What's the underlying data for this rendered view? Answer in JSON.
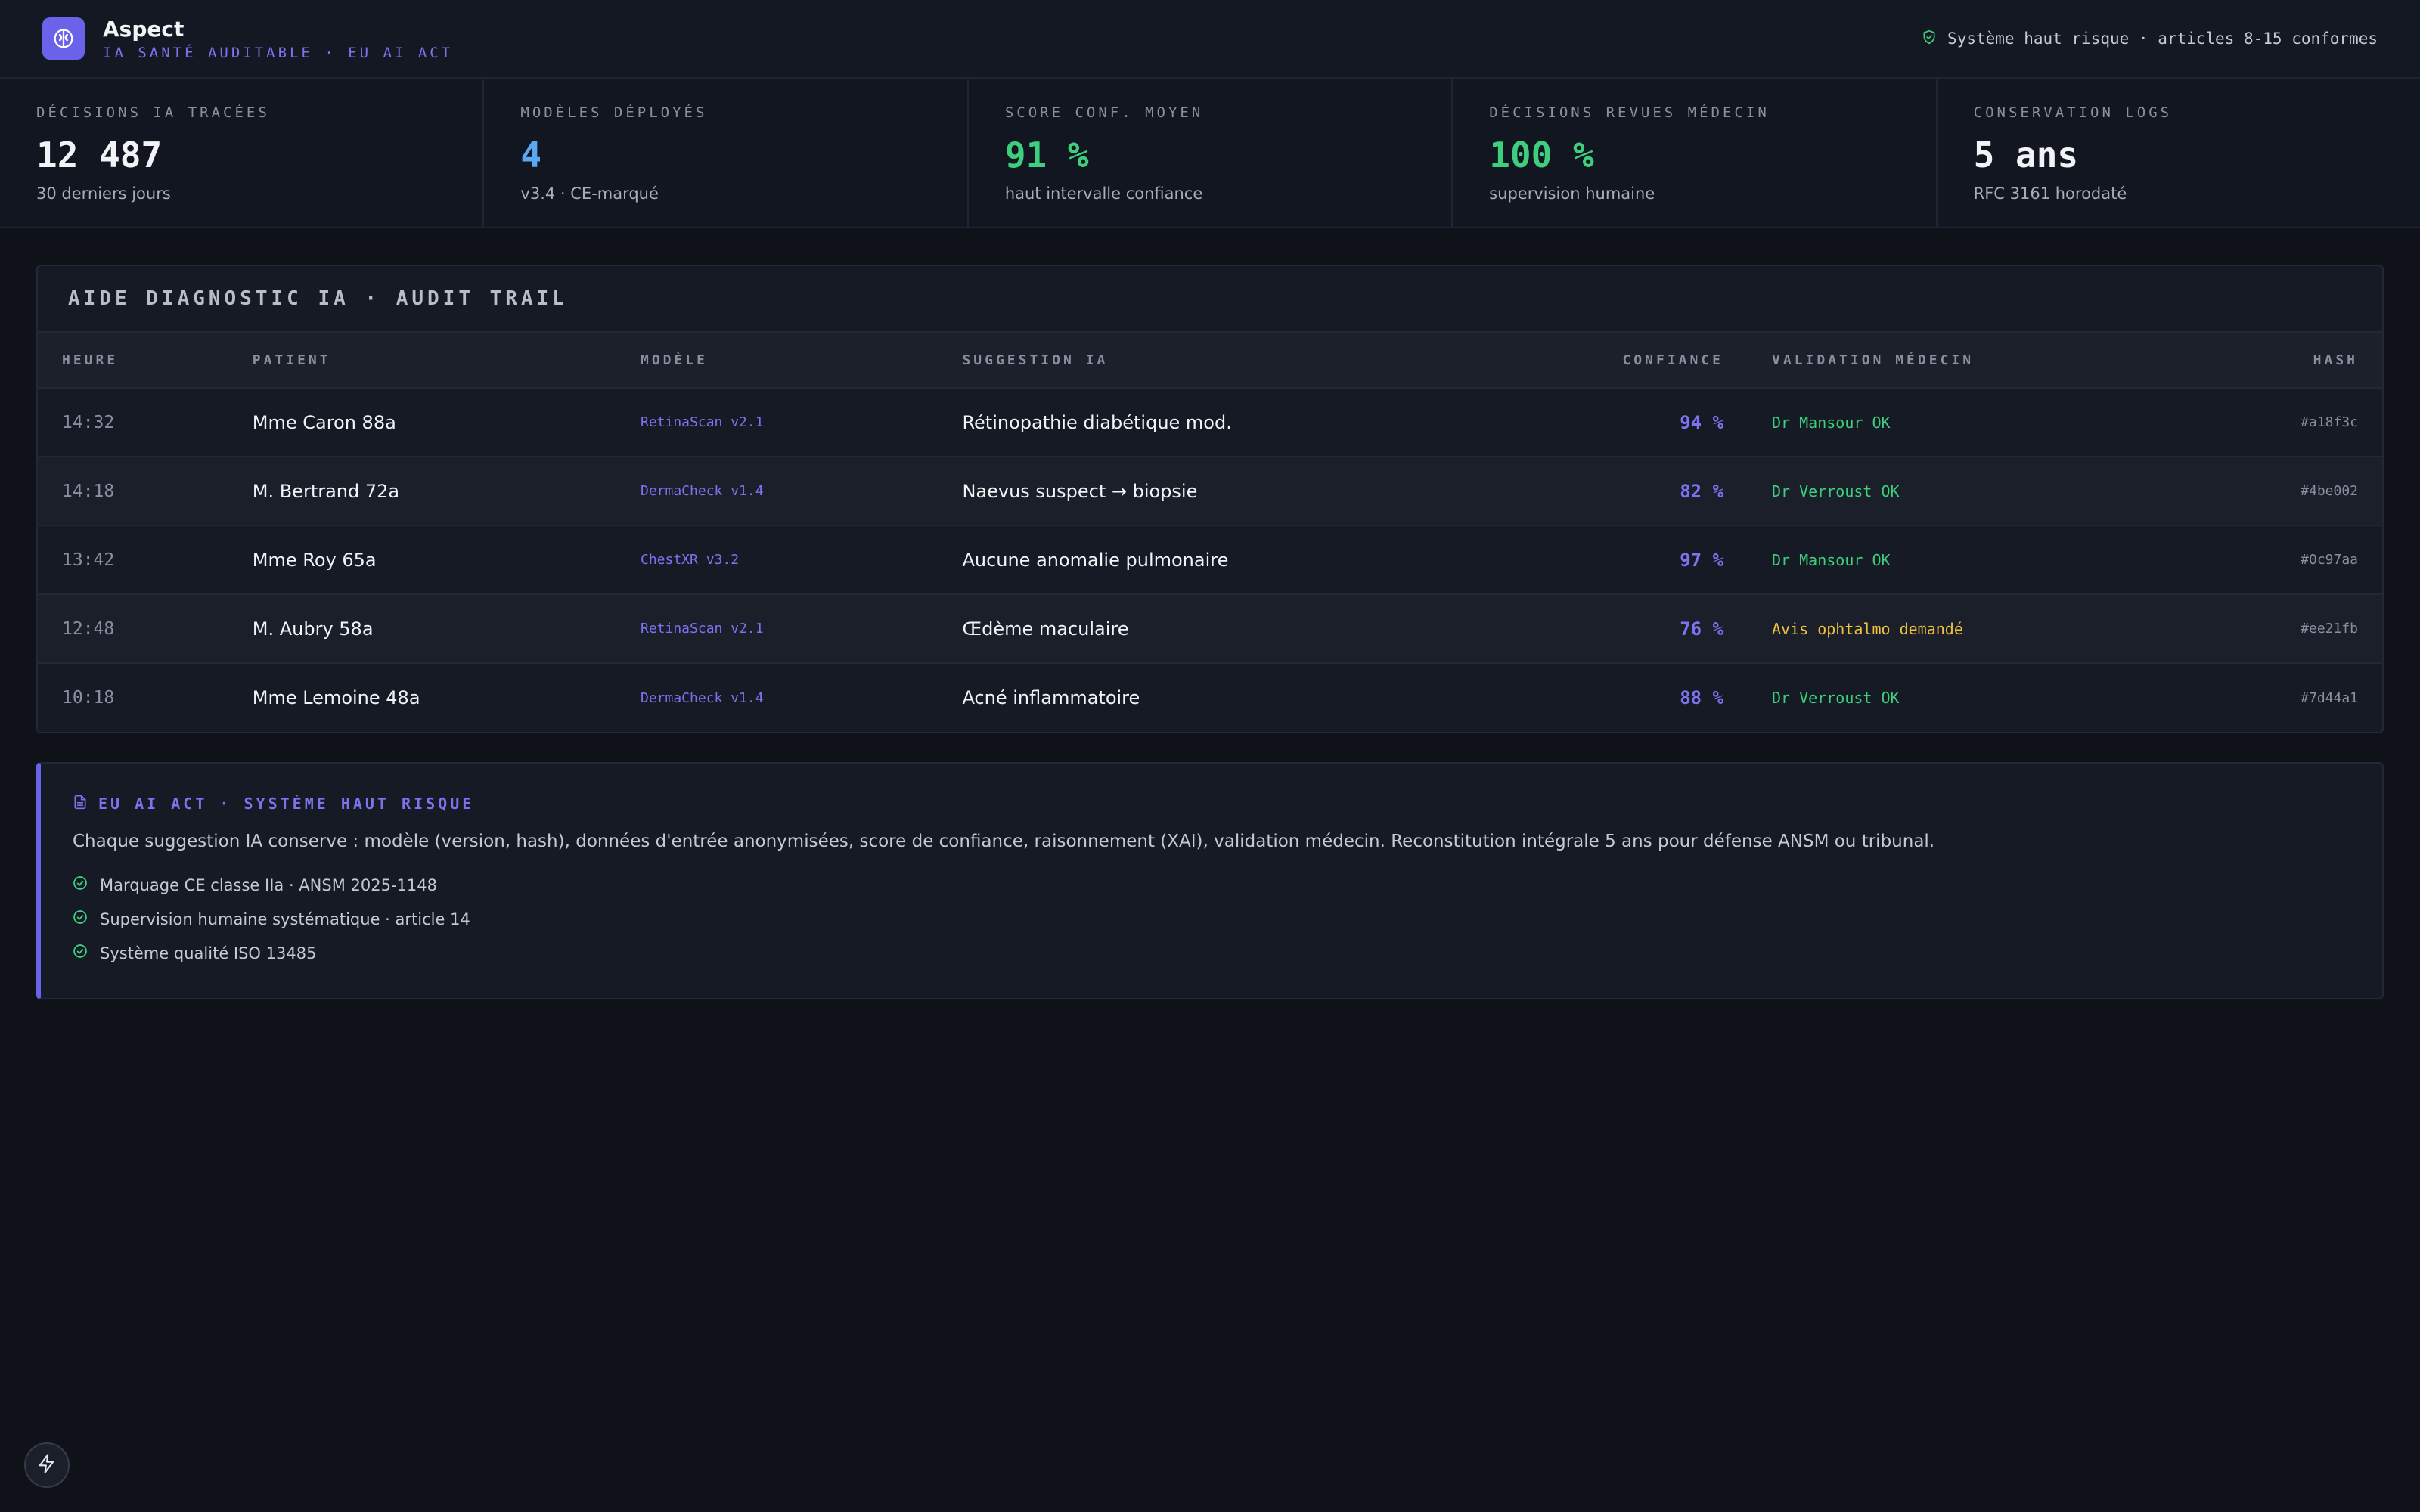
{
  "header": {
    "app_name": "Aspect",
    "subtitle": "IA SANTÉ AUDITABLE · EU AI ACT",
    "compliance": "Système haut risque · articles 8-15 conformes"
  },
  "kpis": [
    {
      "label": "DÉCISIONS IA TRACÉES",
      "value": "12 487",
      "sub": "30 derniers jours"
    },
    {
      "label": "MODÈLES DÉPLOYÉS",
      "value": "4",
      "sub": "v3.4 · CE-marqué"
    },
    {
      "label": "SCORE CONF. MOYEN",
      "value": "91 %",
      "sub": "haut intervalle confiance"
    },
    {
      "label": "DÉCISIONS REVUES MÉDECIN",
      "value": "100 %",
      "sub": "supervision humaine"
    },
    {
      "label": "CONSERVATION LOGS",
      "value": "5 ans",
      "sub": "RFC 3161 horodaté"
    }
  ],
  "kpi_colors": [
    "#f2f3f7",
    "#5aa9f0",
    "#3ecf7e",
    "#3ecf7e",
    "#f2f3f7"
  ],
  "audit": {
    "title": "AIDE DIAGNOSTIC IA · AUDIT TRAIL",
    "columns": [
      "HEURE",
      "PATIENT",
      "MODÈLE",
      "SUGGESTION IA",
      "CONFIANCE",
      "VALIDATION MÉDECIN",
      "HASH"
    ],
    "rows": [
      {
        "time": "14:32",
        "patient": "Mme Caron 88a",
        "model": "RetinaScan v2.1",
        "suggestion": "Rétinopathie diabétique mod.",
        "confidence": "94 %",
        "validation": "Dr Mansour OK",
        "status": "ok",
        "hash": "#a18f3c"
      },
      {
        "time": "14:18",
        "patient": "M. Bertrand 72a",
        "model": "DermaCheck v1.4",
        "suggestion": "Naevus suspect → biopsie",
        "confidence": "82 %",
        "validation": "Dr Verroust OK",
        "status": "ok",
        "hash": "#4be002"
      },
      {
        "time": "13:42",
        "patient": "Mme Roy 65a",
        "model": "ChestXR v3.2",
        "suggestion": "Aucune anomalie pulmonaire",
        "confidence": "97 %",
        "validation": "Dr Mansour OK",
        "status": "ok",
        "hash": "#0c97aa"
      },
      {
        "time": "12:48",
        "patient": "M. Aubry 58a",
        "model": "RetinaScan v2.1",
        "suggestion": "Œdème maculaire",
        "confidence": "76 %",
        "validation": "Avis ophtalmo demandé",
        "status": "pending",
        "hash": "#ee21fb"
      },
      {
        "time": "10:18",
        "patient": "Mme Lemoine 48a",
        "model": "DermaCheck v1.4",
        "suggestion": "Acné inflammatoire",
        "confidence": "88 %",
        "validation": "Dr Verroust OK",
        "status": "ok",
        "hash": "#7d44a1"
      }
    ]
  },
  "status_colors": {
    "ok": "#3ecf7e",
    "pending": "#f0c23e"
  },
  "note": {
    "title": "EU AI ACT · SYSTÈME HAUT RISQUE",
    "body": "Chaque suggestion IA conserve : modèle (version, hash), données d'entrée anonymisées, score de confiance, raisonnement (XAI), validation médecin. Reconstitution intégrale 5 ans pour défense ANSM ou tribunal.",
    "items": [
      "Marquage CE classe IIa · ANSM 2025-1148",
      "Supervision humaine systématique · article 14",
      "Système qualité ISO 13485"
    ]
  },
  "icons": {
    "logo": "brain-icon",
    "compliance": "shield-check-icon",
    "note": "document-icon",
    "check": "check-circle-icon",
    "fab": "bolt-icon"
  },
  "colors": {
    "accent": "#6a62e8",
    "success": "#3ecf7e",
    "warning": "#f0c23e",
    "background": "#0f1218"
  }
}
